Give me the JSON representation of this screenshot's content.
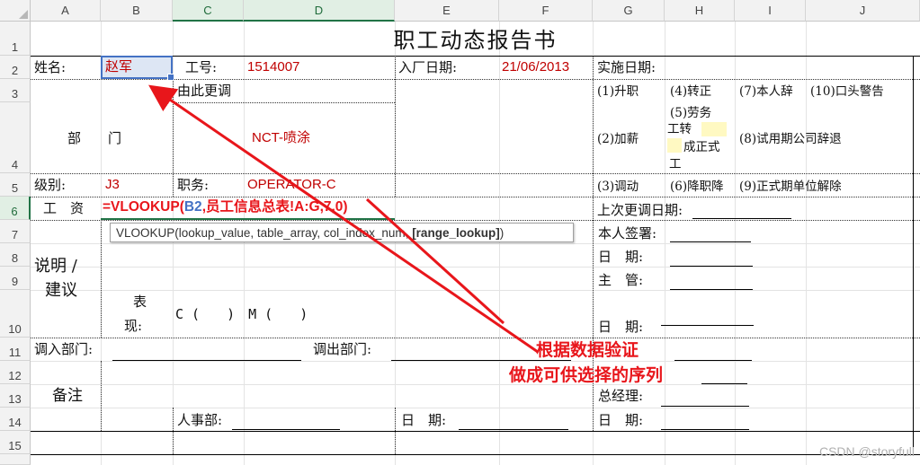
{
  "columns": [
    "A",
    "B",
    "C",
    "D",
    "E",
    "F",
    "G",
    "H",
    "I",
    "J"
  ],
  "rows": [
    "1",
    "2",
    "3",
    "4",
    "5",
    "6",
    "7",
    "8",
    "9",
    "10",
    "11",
    "12",
    "13",
    "14",
    "15"
  ],
  "sheet": {
    "title": "职工动态报告书",
    "name_label": "姓名:",
    "name_value": "赵军",
    "empno_label": "工号:",
    "empno_value": "1514007",
    "hire_label": "入厂日期:",
    "hire_value": "21/06/2013",
    "impl_label": "实施日期:",
    "transfer_label": "由此更调",
    "dept_label": "部　　门",
    "dept_value": "NCT-喷涂",
    "opt1": "(1)升职",
    "opt4": "(4)转正",
    "opt7": "(7)本人辞",
    "opt10": "(10)口头警告",
    "opt2": "(2)加薪",
    "opt5_line1": "(5)劳务",
    "opt5_line2": "工转",
    "opt5_line3": "成正式",
    "opt5_line4": "工",
    "opt8": "(8)试用期公司辞退",
    "level_label": "级别:",
    "level_value": "J3",
    "position_label": "职务:",
    "position_value": "OPERATOR-C",
    "opt3": "(3)调动",
    "opt6": "(6)降职降",
    "opt9": "(9)正式期单位解除",
    "salary_label": "工　资",
    "formula_prefix": "=VLOOKUP(",
    "formula_ref": "B2",
    "formula_rest": ",员工信息总表!A:G,7,0)",
    "last_adjust_label": "上次更调日期:",
    "tooltip_text": "VLOOKUP(lookup_value, table_array, col_index_num, ",
    "tooltip_bold": "[range_lookup]",
    "tooltip_end": ")",
    "note_label_1": "说明 /",
    "note_label_2": "建议",
    "sign_label": "本人签署:",
    "date_label": "日　期:",
    "supervisor_label": "主　管:",
    "perf_label_1": "表",
    "perf_label_2": "现:",
    "perf_scale": "C (　　)　M (　　)",
    "date_label_2": "日　期:",
    "in_dept_label": "调入部门:",
    "out_dept_label": "调出部门:",
    "remark_label": "备注",
    "gm_label": "总经理:",
    "hr_label": "人事部:",
    "date_label_3": "日　期:",
    "date_label_4": "日　期:"
  },
  "annotation": {
    "line1": "根据数据验证",
    "line2": "做成可供选择的序列"
  },
  "watermark": "CSDN @storyfull",
  "colors": {
    "accent_red": "#e8161b",
    "cell_red": "#c00000",
    "select_green": "#217346",
    "ref_blue": "#4472c4"
  }
}
